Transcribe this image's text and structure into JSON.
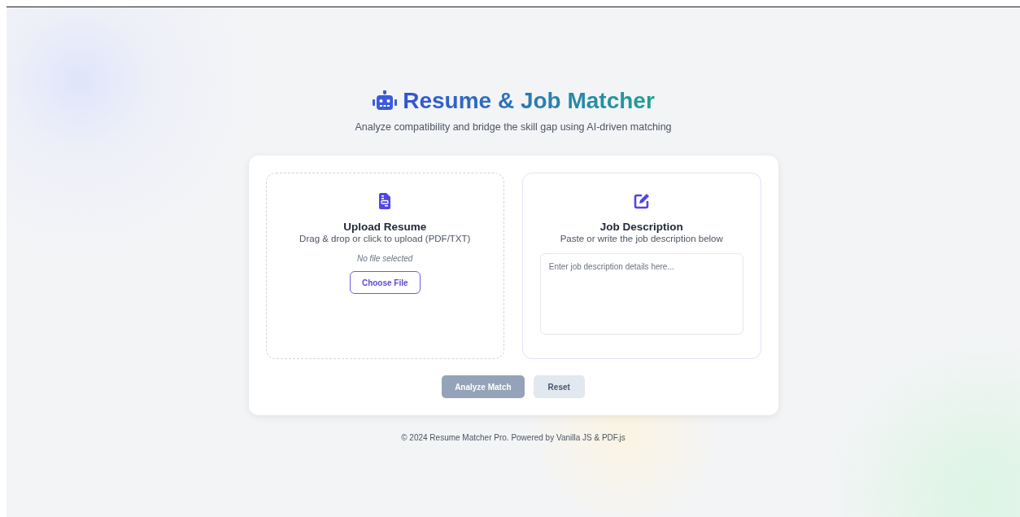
{
  "header": {
    "title": "Resume & Job Matcher",
    "subtitle": "Analyze compatibility and bridge the skill gap using AI-driven matching"
  },
  "upload": {
    "title": "Upload Resume",
    "hint": "Drag & drop or click to upload (PDF/TXT)",
    "file_status": "No file selected",
    "button": "Choose File"
  },
  "job": {
    "title": "Job Description",
    "hint": "Paste or write the job description below",
    "placeholder": "Enter job description details here..."
  },
  "actions": [
    {
      "kind": "primary",
      "label": "Analyze Match",
      "disabled": true
    },
    {
      "kind": "secondary",
      "label": "Reset",
      "disabled": false
    }
  ],
  "footer": "© 2024 Resume Matcher Pro. Powered by Vanilla JS & PDF.js"
}
